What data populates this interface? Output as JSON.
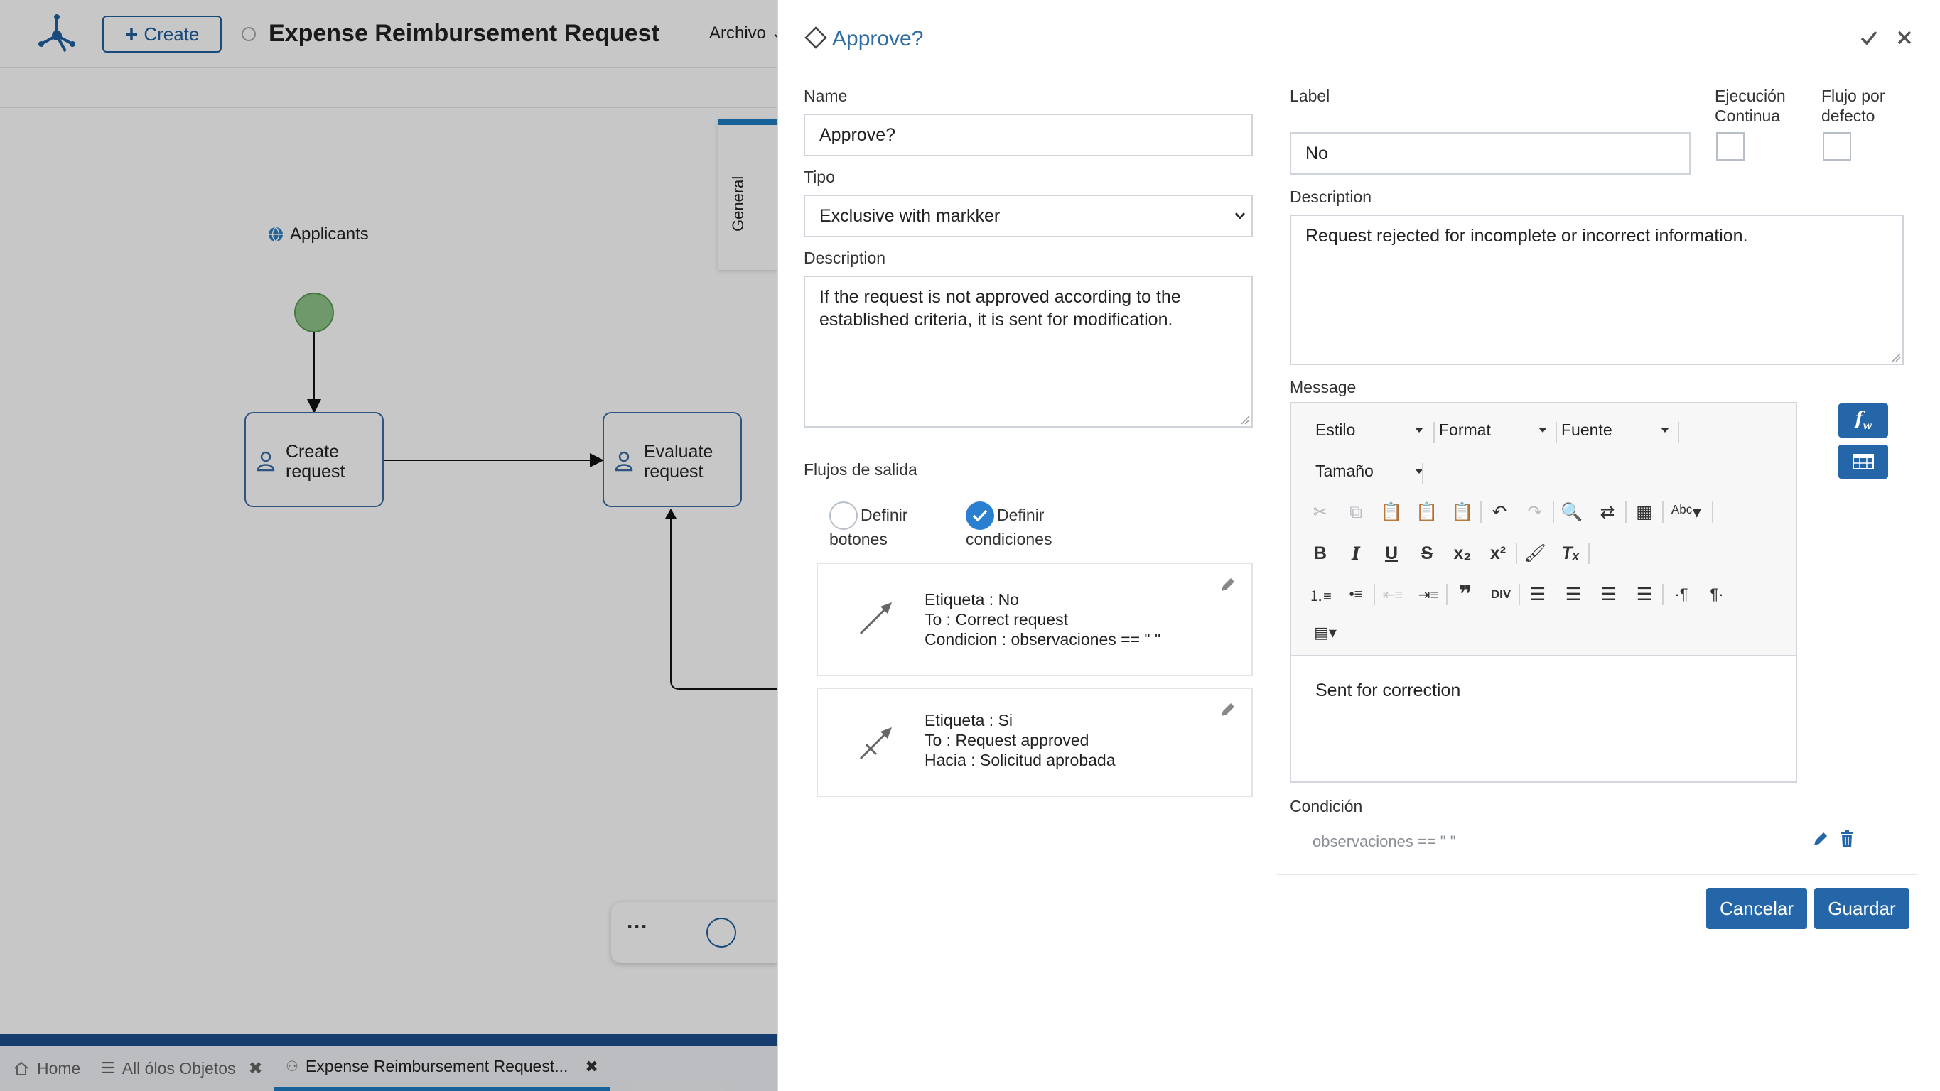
{
  "app": {
    "create_label": "Create",
    "page_title": "Expense Reimbursement Request",
    "menu_archivo": "Archivo",
    "canvas": {
      "lane_label": "Applicants",
      "node_create": "Create\nrequest",
      "node_evaluate": "Evaluate\nrequest",
      "general_tab": "General"
    },
    "tabs": [
      {
        "label": "Home"
      },
      {
        "label": "All ólos Objetos"
      },
      {
        "label": "Expense Reimbursement Request..."
      }
    ]
  },
  "dialog": {
    "title": "Approve?",
    "left": {
      "name_label": "Name",
      "name_value": "Approve?",
      "tipo_label": "Tipo",
      "tipo_value": "Exclusive with markker",
      "description_label": "Description",
      "description_value": "If the request is not approved according to the established criteria, it is sent for modification.",
      "flujos_label": "Flujos de salida",
      "radio_botones_1": "Definir",
      "radio_botones_2": "botones",
      "radio_condiciones_1": "Definir",
      "radio_condiciones_2": "condiciones",
      "flows": [
        {
          "line1": "Etiqueta : No",
          "line2": "To : Correct request",
          "line3": "Condicion : observaciones == \" \""
        },
        {
          "line1": "Etiqueta : Si",
          "line2": "To : Request approved",
          "line3": "Hacia : Solicitud aprobada"
        }
      ]
    },
    "right": {
      "label_label": "Label",
      "label_value": "No",
      "ejecucion_1": "Ejecución",
      "ejecucion_2": "Continua",
      "flujo_defecto_1": "Flujo por",
      "flujo_defecto_2": "defecto",
      "description_label": "Description",
      "description_value": "Request rejected for incomplete or incorrect information.",
      "message_label": "Message",
      "editor": {
        "estilo": "Estilo",
        "format": "Format",
        "fuente": "Fuente",
        "tamano": "Tamaño",
        "content": "Sent for correction"
      },
      "condicion_label": "Condición",
      "condicion_value": "observaciones == \" \""
    },
    "buttons": {
      "cancelar": "Cancelar",
      "guardar": "Guardar"
    }
  },
  "colors": {
    "primary": "#2466a8",
    "title_blue": "#2e6da4",
    "dark_bar": "#1d4f8e",
    "start_event": "#8fc48a"
  }
}
